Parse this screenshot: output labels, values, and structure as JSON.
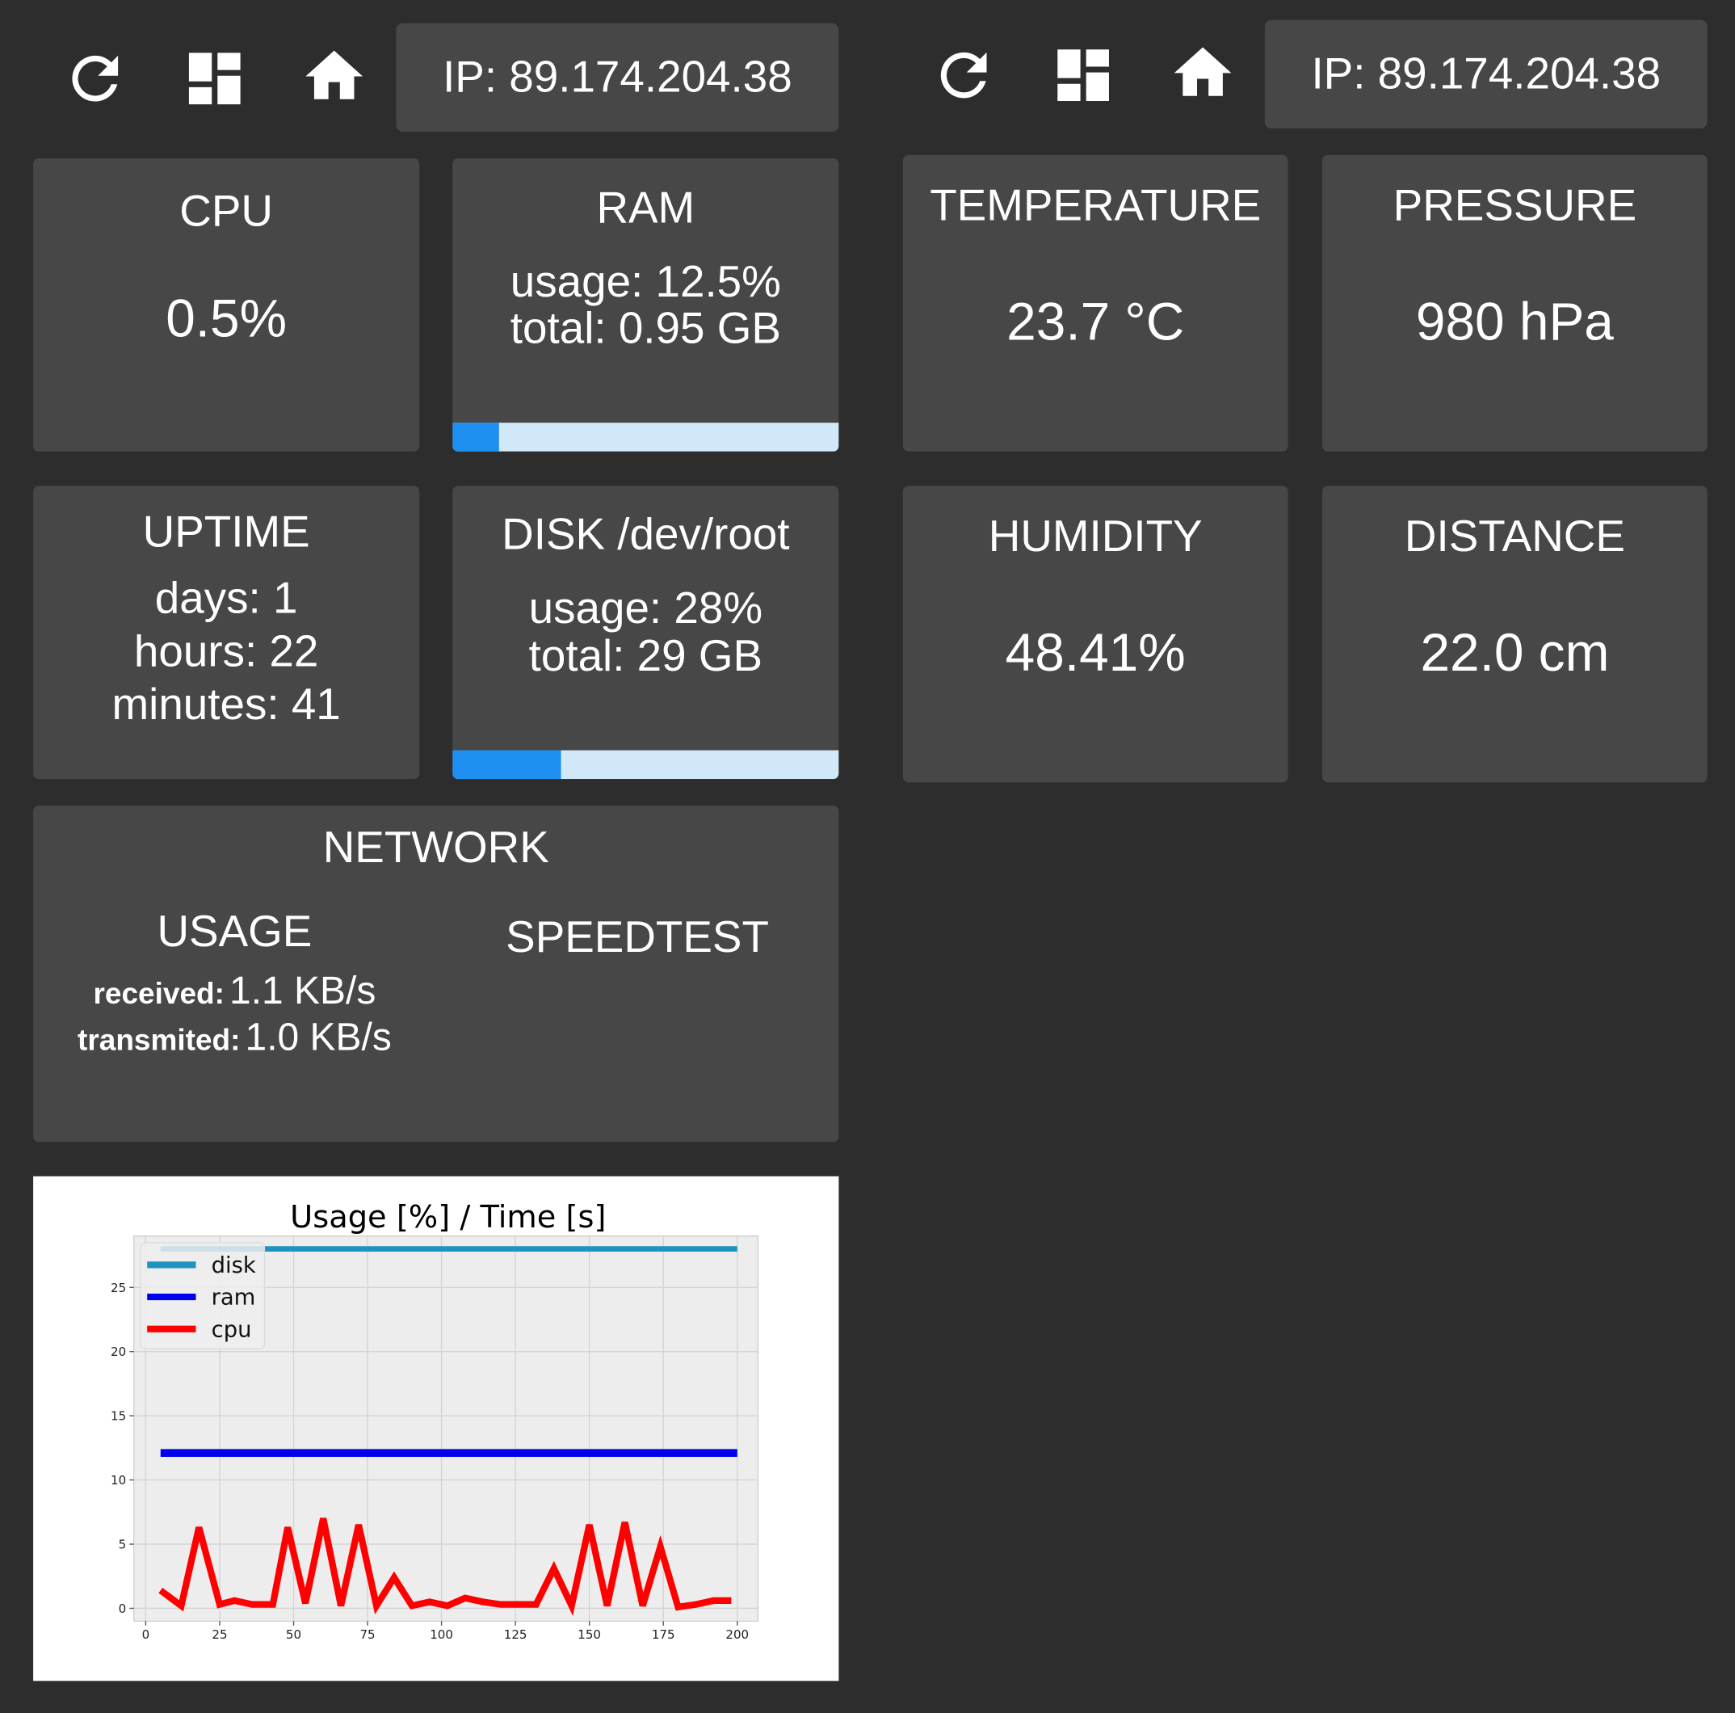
{
  "toolbar_left": {
    "refresh_icon": "refresh-icon",
    "dashboard_icon": "dashboard-icon",
    "home_icon": "home-icon",
    "ip_text": "IP: 89.174.204.38"
  },
  "toolbar_right": {
    "refresh_icon": "refresh-icon",
    "dashboard_icon": "dashboard-icon",
    "home_icon": "home-icon",
    "ip_text": "IP: 89.174.204.38"
  },
  "colors": {
    "background": "#2d2d2d",
    "tile": "#474747",
    "bar_fill": "#1e8ff0",
    "bar_track": "#d0e8f8"
  },
  "cpu": {
    "title": "CPU",
    "value": "0.5%"
  },
  "ram": {
    "title": "RAM",
    "usage": "usage: 12.5%",
    "total": "total: 0.95 GB",
    "bar_fraction": 0.12
  },
  "uptime": {
    "title": "UPTIME",
    "days": "days: 1",
    "hours": "hours: 22",
    "minutes": "minutes: 41"
  },
  "disk": {
    "title": "DISK /dev/root",
    "usage": "usage: 28%",
    "total": "total: 29 GB",
    "bar_fraction": 0.28
  },
  "network": {
    "title": "NETWORK",
    "usage_title": "USAGE",
    "speedtest_title": "SPEEDTEST",
    "received_label": "received:",
    "received_value": "1.1 KB/s",
    "transmitted_label": "transmited:",
    "transmitted_value": "1.0 KB/s"
  },
  "temperature": {
    "title": "TEMPERATURE",
    "value": "23.7 °C"
  },
  "pressure": {
    "title": "PRESSURE",
    "value": "980 hPa"
  },
  "humidity": {
    "title": "HUMIDITY",
    "value": "48.41%"
  },
  "distance": {
    "title": "DISTANCE",
    "value": "22.0 cm"
  },
  "chart_data": {
    "type": "line",
    "title": "Usage [%] / Time [s]",
    "xlim": [
      -4,
      207
    ],
    "ylim": [
      -1,
      29
    ],
    "xticks": [
      0,
      25,
      50,
      75,
      100,
      125,
      150,
      175,
      200
    ],
    "yticks": [
      0,
      5,
      10,
      15,
      20,
      25
    ],
    "grid": true,
    "legend_position": "top-left",
    "series": [
      {
        "name": "disk",
        "color": "#1f93bf",
        "x": [
          5,
          200
        ],
        "y": [
          28,
          28
        ]
      },
      {
        "name": "ram",
        "color": "#0000ee",
        "x": [
          5,
          200
        ],
        "y": [
          12.1,
          12.1
        ]
      },
      {
        "name": "cpu",
        "color": "#ff0000",
        "x": [
          5,
          12,
          18,
          25,
          30,
          36,
          43,
          48,
          54,
          60,
          66,
          72,
          78,
          84,
          90,
          96,
          102,
          108,
          114,
          120,
          126,
          132,
          138,
          144,
          150,
          156,
          162,
          168,
          174,
          180,
          186,
          192,
          198
        ],
        "y": [
          1.4,
          0.2,
          6.3,
          0.3,
          0.6,
          0.3,
          0.3,
          6.3,
          0.4,
          7.0,
          0.2,
          6.5,
          0.2,
          2.4,
          0.2,
          0.5,
          0.2,
          0.8,
          0.5,
          0.3,
          0.3,
          0.3,
          3.1,
          0.2,
          6.5,
          0.2,
          6.7,
          0.2,
          4.8,
          0.1,
          0.3,
          0.6,
          0.6
        ]
      }
    ]
  }
}
